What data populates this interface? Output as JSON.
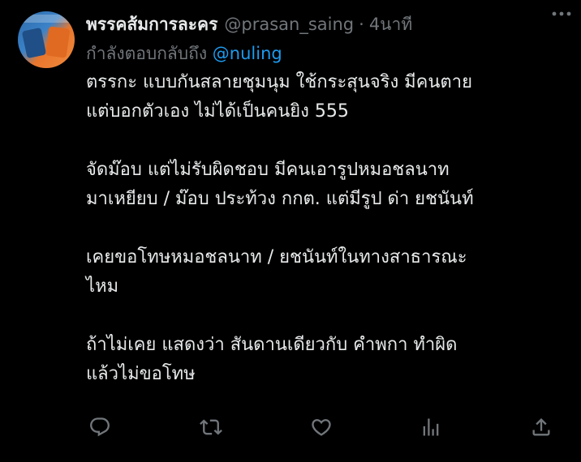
{
  "user": {
    "display_name": "พรรคส้มการละคร",
    "handle": "@prasan_saing",
    "separator": "·",
    "time": "4นาที"
  },
  "reply": {
    "prefix": "กำลังตอบกลับถึง",
    "mention": "@nuling"
  },
  "body": {
    "paragraphs": [
      [
        "ตรรกะ แบบกันสลายชุมนุม ใช้กระสุนจริง มีคนตาย",
        "แต่บอกตัวเอง ไม่ได้เป็นคนยิง 555"
      ],
      [
        "จัดม๊อบ  แต่ไม่รับผิดชอบ มีคนเอารูปหมอชลนาท",
        "มาเหยียบ / ม๊อบ ประท้วง กกต. แต่มีรูป ด่า ยชนันท์"
      ],
      [
        "เคยขอโทษหมอชลนาท / ยชนันท์ในทางสาธารณะ",
        "ไหม"
      ],
      [
        "ถ้าไม่เคย  แสดงว่า  สันดานเดียวกับ คำพกา  ทำผิด",
        "แล้วไม่ขอโทษ"
      ]
    ]
  },
  "actions": [
    {
      "name": "reply-icon"
    },
    {
      "name": "retweet-icon"
    },
    {
      "name": "like-icon"
    },
    {
      "name": "views-icon"
    },
    {
      "name": "share-icon"
    }
  ],
  "colors": {
    "background": "#000000",
    "text": "#e7e9ea",
    "secondary": "#71767b",
    "accent": "#1d9bf0"
  }
}
